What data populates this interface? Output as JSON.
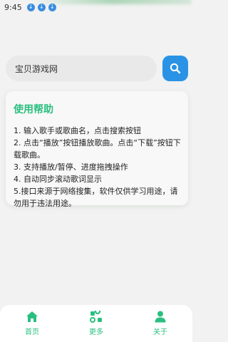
{
  "status_bar": {
    "time": "9:45",
    "download_icons": [
      "download-icon",
      "download-icon",
      "download-icon"
    ]
  },
  "search": {
    "value": "宝贝游戏网",
    "button_icon": "search-icon"
  },
  "help": {
    "title": "使用帮助",
    "items": [
      "1. 输入歌手或歌曲名，点击搜索按钮",
      "2. 点击“播放”按钮播放歌曲。点击“下载”按钮下载歌曲。",
      "3. 支持播放/暂停、进度拖拽操作",
      "4. 自动同步滚动歌词显示",
      "5.接口来源于网络搜集，软件仅供学习用途，请勿用于违法用途。"
    ]
  },
  "nav": {
    "items": [
      {
        "label": "首页",
        "icon": "home-icon"
      },
      {
        "label": "更多",
        "icon": "more-icon"
      },
      {
        "label": "关于",
        "icon": "user-icon"
      }
    ]
  },
  "colors": {
    "accent": "#2bbf7f",
    "search_button": "#2a93e6",
    "background": "#f1f2f1"
  }
}
